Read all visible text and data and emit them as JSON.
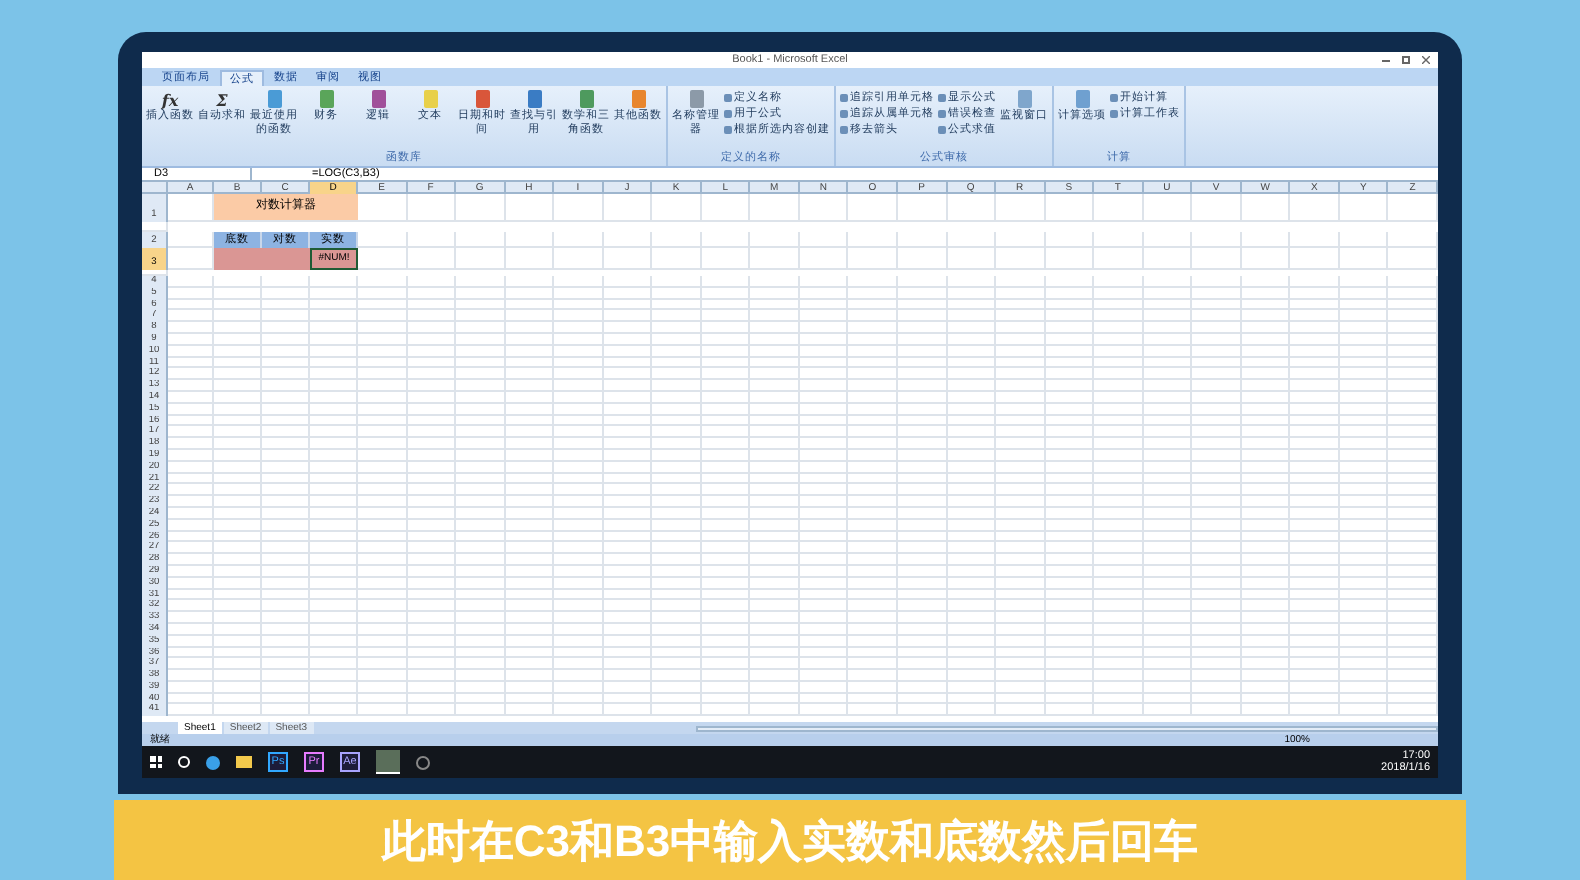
{
  "window": {
    "title": "Book1 - Microsoft Excel"
  },
  "tabs": [
    {
      "label": "页面布局",
      "selected": false
    },
    {
      "label": "公式",
      "selected": true
    },
    {
      "label": "数据",
      "selected": false
    },
    {
      "label": "审阅",
      "selected": false
    },
    {
      "label": "视图",
      "selected": false
    }
  ],
  "ribbon": [
    {
      "label": "函数库",
      "buttons": [
        {
          "kind": "glyph",
          "glyph": "fx",
          "label": "插入函数"
        },
        {
          "kind": "glyph",
          "glyph": "Σ",
          "label": "自动求和"
        },
        {
          "kind": "book",
          "color": "#4a9bd6",
          "label": "最近使用的函数"
        },
        {
          "kind": "book",
          "color": "#5aa55a",
          "label": "财务"
        },
        {
          "kind": "book",
          "color": "#a0509a",
          "label": "逻辑"
        },
        {
          "kind": "book",
          "color": "#e8d04a",
          "label": "文本"
        },
        {
          "kind": "book",
          "color": "#d9563a",
          "label": "日期和时间"
        },
        {
          "kind": "book",
          "color": "#3a7cc4",
          "label": "查找与引用"
        },
        {
          "kind": "book",
          "color": "#4e9a5e",
          "label": "数学和三角函数"
        },
        {
          "kind": "book",
          "color": "#e8862e",
          "label": "其他函数"
        }
      ]
    },
    {
      "label": "定义的名称",
      "buttons": [
        {
          "kind": "book",
          "color": "#8c9aa8",
          "label": "名称管理器"
        },
        {
          "kind": "small",
          "label": "定义名称"
        },
        {
          "kind": "small",
          "label": "用于公式"
        },
        {
          "kind": "small",
          "label": "根据所选内容创建"
        }
      ]
    },
    {
      "label": "公式审核",
      "buttons": [
        {
          "kind": "small",
          "label": "追踪引用单元格"
        },
        {
          "kind": "small",
          "label": "追踪从属单元格"
        },
        {
          "kind": "small",
          "label": "移去箭头"
        },
        {
          "kind": "small",
          "label": "显示公式"
        },
        {
          "kind": "small",
          "label": "错误检查"
        },
        {
          "kind": "small",
          "label": "公式求值"
        },
        {
          "kind": "book",
          "color": "#7fa6cc",
          "label": "监视窗口"
        }
      ]
    },
    {
      "label": "计算",
      "buttons": [
        {
          "kind": "book",
          "color": "#6fa0d0",
          "label": "计算选项"
        },
        {
          "kind": "small",
          "label": "开始计算"
        },
        {
          "kind": "small",
          "label": "计算工作表"
        }
      ]
    }
  ],
  "formula_bar": {
    "name_box": "D3",
    "formula": "=LOG(C3,B3)"
  },
  "columns": [
    "A",
    "B",
    "C",
    "D",
    "E",
    "F",
    "G",
    "H",
    "I",
    "J",
    "K",
    "L",
    "M",
    "N",
    "O",
    "P",
    "Q",
    "R",
    "S",
    "T",
    "U",
    "V",
    "W",
    "X",
    "Y",
    "Z"
  ],
  "row_headers": [
    "1",
    "2",
    "3",
    "4",
    "5",
    "6",
    "7",
    "8",
    "9",
    "10",
    "11",
    "12",
    "13",
    "14",
    "15",
    "16",
    "17",
    "18",
    "19",
    "20",
    "21",
    "22",
    "23",
    "24",
    "25",
    "26",
    "27",
    "28",
    "29",
    "30",
    "31",
    "32",
    "33",
    "34",
    "35",
    "36",
    "37",
    "38",
    "39",
    "40",
    "41"
  ],
  "calculator": {
    "title": "对数计算器",
    "headers": [
      "底数",
      "对数",
      "实数"
    ],
    "values": [
      {
        "selected": false
      },
      {
        "selected": false
      },
      {
        "text": "#NUM!",
        "selected": true
      }
    ]
  },
  "sheet_tabs": [
    {
      "label": "Sheet1",
      "selected": true
    },
    {
      "label": "Sheet2",
      "selected": false
    },
    {
      "label": "Sheet3",
      "selected": false
    }
  ],
  "status_bar": {
    "status": "就绪",
    "zoom": "100%"
  },
  "taskbar": {
    "apps": [
      {
        "label": "Ps",
        "color": "#31a8ff"
      },
      {
        "label": "Pr",
        "color": "#e77cff"
      },
      {
        "label": "Ae",
        "color": "#a8a4ff"
      }
    ],
    "time": "17:00",
    "date": "2018/1/16"
  },
  "subtitle": "此时在C3和B3中输入实数和底数然后回车"
}
